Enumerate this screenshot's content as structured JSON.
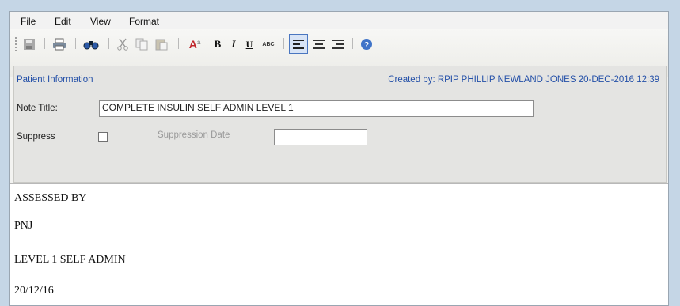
{
  "menu": {
    "file": "File",
    "edit": "Edit",
    "view": "View",
    "format": "Format"
  },
  "toolbar": {
    "icons": [
      "save-icon",
      "print-icon",
      "find-icon",
      "cut-icon",
      "copy-icon",
      "paste-icon",
      "font-color-icon",
      "bold-icon",
      "italic-icon",
      "underline-icon",
      "spellcheck-icon",
      "align-left-icon",
      "align-center-icon",
      "align-right-icon",
      "help-icon"
    ],
    "bold": "B",
    "italic": "I",
    "underline": "U",
    "spell": "ABC",
    "fontcolor": "A"
  },
  "patient_info": {
    "heading": "Patient Information",
    "created_by": "Created by: RPIP PHILLIP NEWLAND JONES 20-DEC-2016 12:39",
    "note_title_label": "Note Title:",
    "note_title_value": "COMPLETE INSULIN SELF ADMIN LEVEL 1",
    "suppress_label": "Suppress",
    "suppress_checked": false,
    "suppression_date_label": "Suppression Date",
    "suppression_date_value": ""
  },
  "note_body": {
    "lines": [
      "ASSESSED BY",
      "PNJ",
      "LEVEL 1 SELF ADMIN",
      "20/12/16"
    ]
  },
  "colors": {
    "link_blue": "#2450a8",
    "background": "#c5d6e6"
  }
}
